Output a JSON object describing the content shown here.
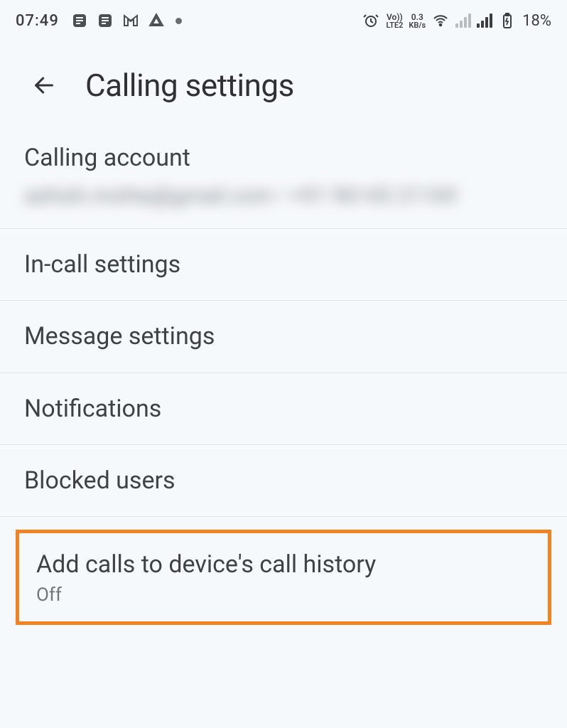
{
  "status": {
    "time": "07:49",
    "lte_top": "Vo))",
    "lte_bot": "LTE2",
    "data_rate_top": "0.3",
    "data_rate_bot": "KB/s",
    "battery_pct": "18%"
  },
  "toolbar": {
    "title": "Calling settings"
  },
  "rows": {
    "account_label": "Calling account",
    "account_sub": "ashish.mohta@gmail.com • +91 96143 21169",
    "incall": "In-call settings",
    "message": "Message settings",
    "notifications": "Notifications",
    "blocked": "Blocked users",
    "history_label": "Add calls to device's call history",
    "history_state": "Off"
  }
}
